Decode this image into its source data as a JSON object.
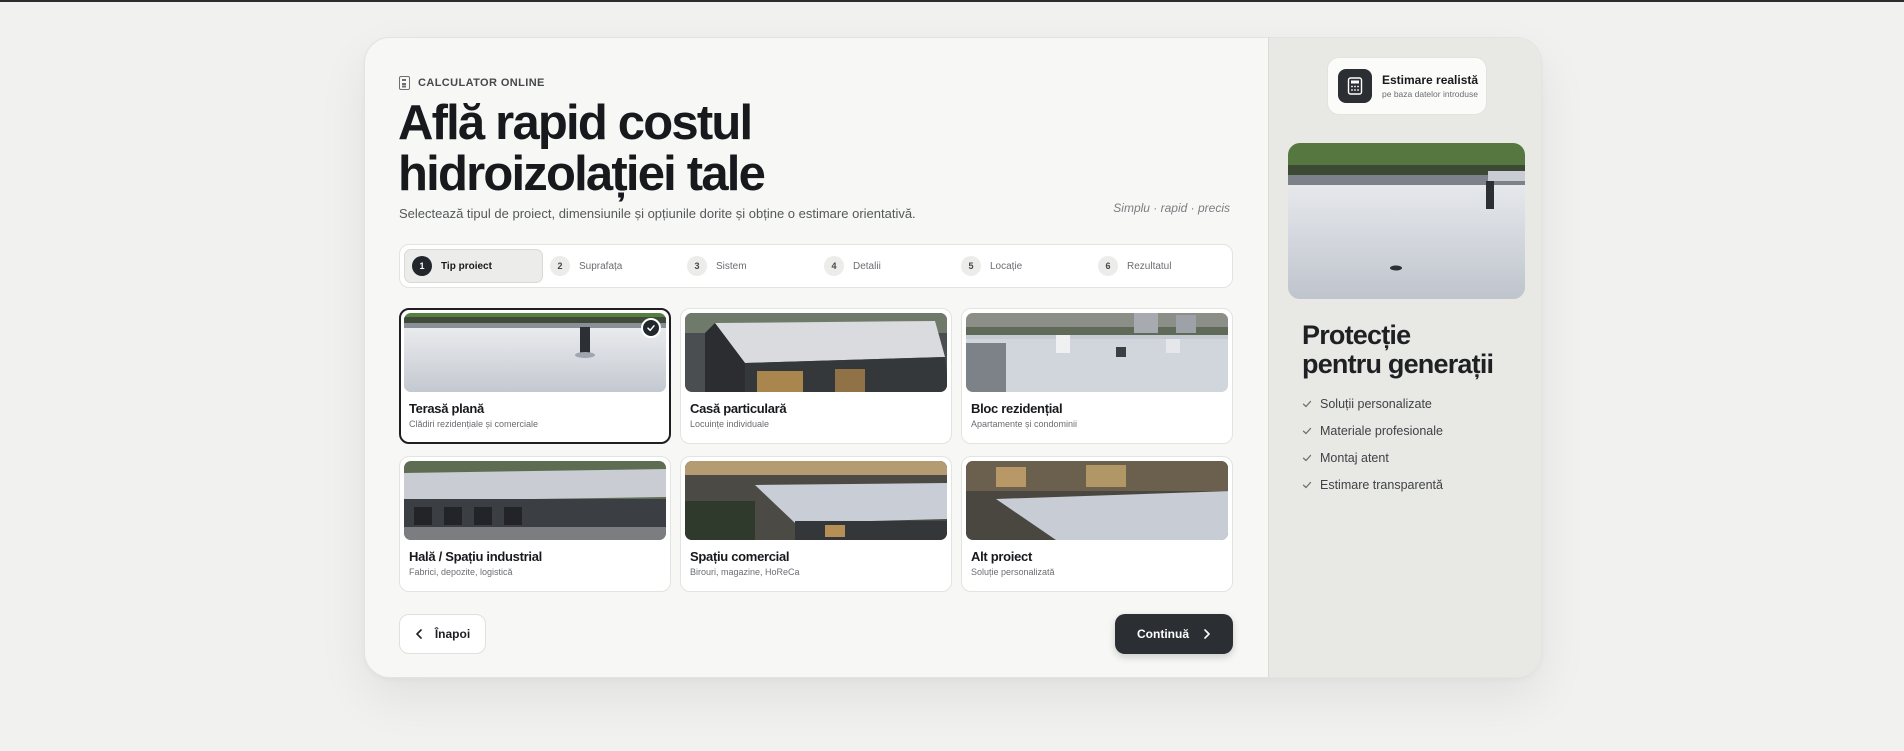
{
  "eyebrow": {
    "icon": "calculator-icon",
    "label": "CALCULATOR ONLINE"
  },
  "hero": {
    "title_line1": "Află rapid costul",
    "title_line2": "hidroizolației tale",
    "subtitle": "Selectează tipul de proiect, dimensiunile și opțiunile dorite și obține o estimare orientativă.",
    "tagline": "Simplu · rapid · precis"
  },
  "steps": [
    {
      "number": "1",
      "label": "Tip proiect",
      "active": true
    },
    {
      "number": "2",
      "label": "Suprafața",
      "active": false
    },
    {
      "number": "3",
      "label": "Sistem",
      "active": false
    },
    {
      "number": "4",
      "label": "Detalii",
      "active": false
    },
    {
      "number": "5",
      "label": "Locație",
      "active": false
    },
    {
      "number": "6",
      "label": "Rezultatul",
      "active": false
    }
  ],
  "options": [
    {
      "title": "Terasă plană",
      "description": "Clădiri rezidențiale și comerciale",
      "selected": true
    },
    {
      "title": "Casă particulară",
      "description": "Locuințe individuale",
      "selected": false
    },
    {
      "title": "Bloc rezidențial",
      "description": "Apartamente și condominii",
      "selected": false
    },
    {
      "title": "Hală / Spațiu industrial",
      "description": "Fabrici, depozite, logistică",
      "selected": false
    },
    {
      "title": "Spațiu comercial",
      "description": "Birouri, magazine, HoReCa",
      "selected": false
    },
    {
      "title": "Alt proiect",
      "description": "Soluție personalizată",
      "selected": false
    }
  ],
  "nav": {
    "back_label": "Înapoi",
    "next_label": "Continuă"
  },
  "sidebar": {
    "badge_title": "Estimare realistă",
    "badge_subtitle": "pe baza datelor introduse",
    "headline_line1": "Protecție",
    "headline_line2": "pentru generații",
    "benefits": [
      "Soluții personalizate",
      "Materiale profesionale",
      "Montaj atent",
      "Estimare transparentă"
    ]
  },
  "colors": {
    "accent_dark": "#23262a",
    "page_bg": "#f1f1ef",
    "card_bg": "#f7f7f5"
  }
}
